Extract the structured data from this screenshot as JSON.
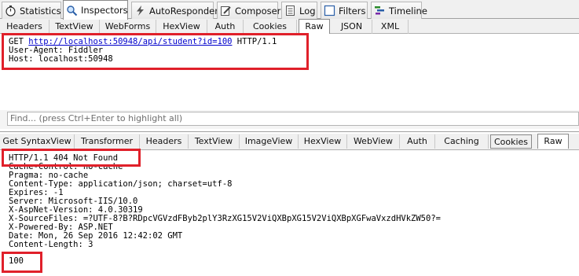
{
  "main_tabs": [
    {
      "label": "Statistics",
      "icon": "stopwatch-icon"
    },
    {
      "label": "Inspectors",
      "icon": "magnifier-icon"
    },
    {
      "label": "AutoResponder",
      "icon": "lightning-icon"
    },
    {
      "label": "Composer",
      "icon": "pencil-icon"
    },
    {
      "label": "Log",
      "icon": "log-icon"
    },
    {
      "label": "Filters",
      "icon": "checkbox-icon"
    },
    {
      "label": "Timeline",
      "icon": "timeline-icon"
    }
  ],
  "request": {
    "tabs": [
      "Headers",
      "TextView",
      "WebForms",
      "HexView",
      "Auth",
      "Cookies",
      "Raw",
      "JSON",
      "XML"
    ],
    "active_tab": "Raw",
    "method": "GET ",
    "url": "http://localhost:50948/api/student?id=100",
    "protocol": " HTTP/1.1",
    "headers": [
      "User-Agent: Fiddler",
      "Host: localhost:50948"
    ],
    "find_placeholder": "Find... (press Ctrl+Enter to highlight all)"
  },
  "response": {
    "tabs": [
      "Get SyntaxView",
      "Transformer",
      "Headers",
      "TextView",
      "ImageView",
      "HexView",
      "WebView",
      "Auth",
      "Caching",
      "Cookies",
      "Raw"
    ],
    "active_tab": "Raw",
    "status_line": "HTTP/1.1 404 Not Found",
    "headers": [
      "Cache-Control: no-cache",
      "Pragma: no-cache",
      "Content-Type: application/json; charset=utf-8",
      "Expires: -1",
      "Server: Microsoft-IIS/10.0",
      "X-AspNet-Version: 4.0.30319",
      "X-SourceFiles: =?UTF-8?B?RDpcVGVzdFByb2plY3RzXG15V2ViQXBpXG15V2ViQXBpXGFwaVxzdHVkZW50?=",
      "X-Powered-By: ASP.NET",
      "Date: Mon, 26 Sep 2016 12:42:02 GMT",
      "Content-Length: 3"
    ],
    "body": "100"
  },
  "colors": {
    "highlight": "#e0202a",
    "link": "#0000cc"
  }
}
